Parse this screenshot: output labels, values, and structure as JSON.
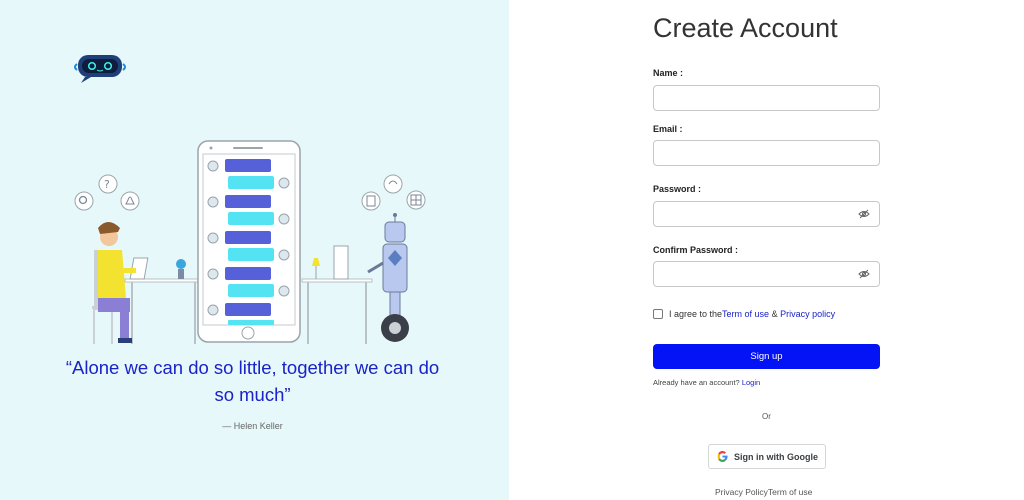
{
  "left": {
    "quote_text": "“Alone we can do so little, together we can do so much”",
    "quote_author": "— Helen Keller"
  },
  "form": {
    "title": "Create Account",
    "name_label": "Name :",
    "name_value": "",
    "email_label": "Email :",
    "email_value": "",
    "password_label": "Password :",
    "password_value": "",
    "confirm_label": "Confirm Password :",
    "confirm_value": "",
    "agree_prefix": "I agree to the ",
    "terms_link": "Term of use",
    "agree_amp": " & ",
    "privacy_link": "Privacy policy",
    "signup_label": "Sign up",
    "have_account_text": "Already have an account? ",
    "login_link": "Login",
    "or_text": "Or",
    "google_label": "Sign in with Google"
  },
  "footer": {
    "privacy_policy": "Privacy Policy",
    "term_of_use": "Term of use"
  },
  "colors": {
    "left_background": "#e6f8f9",
    "accent_blue": "#0313f5",
    "quote_blue": "#1a22c9",
    "chat_bubble_blue": "#5660d8",
    "chat_bubble_cyan": "#53e3f3"
  },
  "icons": [
    "bot-logo-icon",
    "eye-slash-icon",
    "google-icon",
    "checkbox-icon"
  ]
}
